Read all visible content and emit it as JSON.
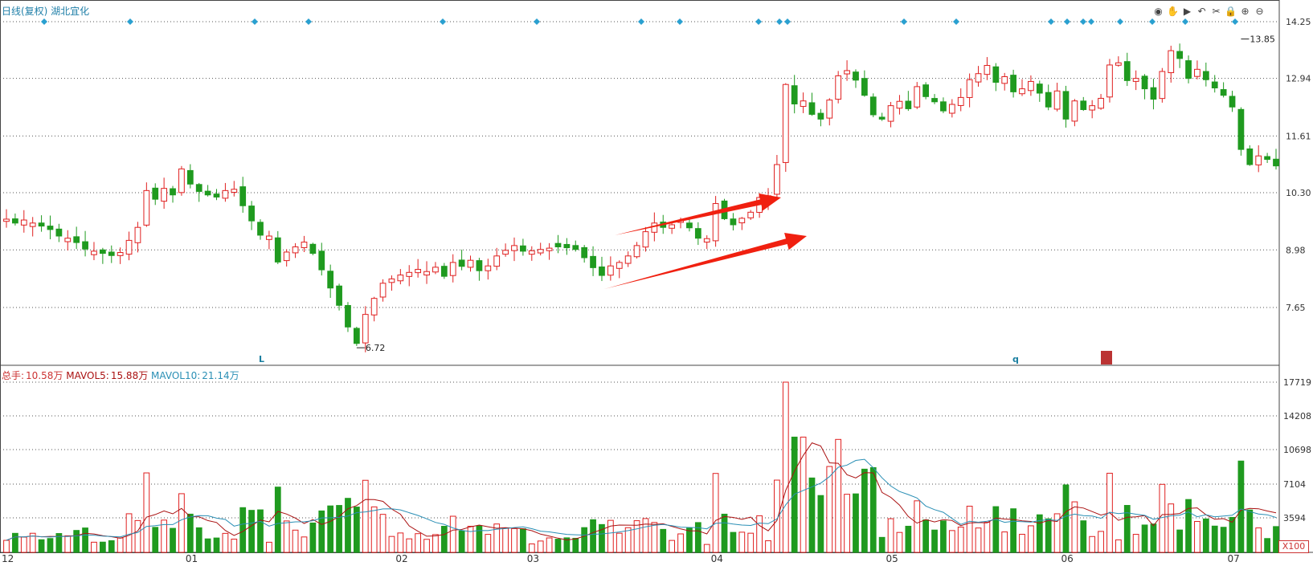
{
  "header": {
    "title": "日线(复权) 湖北宜化",
    "toolbar_icons": [
      "eye-icon",
      "hand-icon",
      "play-icon",
      "undo-icon",
      "cut-icon",
      "lock-icon",
      "zoom-in-icon",
      "zoom-out-icon"
    ]
  },
  "price_axis_labels": [
    "14.25",
    "12.94",
    "11.61",
    "10.30",
    "8.98",
    "7.65"
  ],
  "volume_axis_labels": [
    "17719",
    "14208",
    "10698",
    "7104",
    "3594"
  ],
  "x_axis_labels": [
    "12",
    "01",
    "02",
    "03",
    "04",
    "05",
    "06",
    "07"
  ],
  "markers": {
    "L": "L",
    "q": "q"
  },
  "annotations": {
    "low": "6.72",
    "high": "13.85"
  },
  "volume_legend": {
    "total_label": "总手:",
    "total_value": "10.58万",
    "ma5_label": "MAVOL5:",
    "ma5_value": "15.88万",
    "ma10_label": "MAVOL10:",
    "ma10_value": "21.14万"
  },
  "x100_label": "X100",
  "colors": {
    "up": "#e02020",
    "down": "#1f9a1f",
    "ma5": "#a11",
    "ma10": "#2a8fb5",
    "grid": "#555",
    "arrow": "#f02010"
  },
  "chart_data": {
    "type": "candlestick",
    "title": "日线(复权) 湖北宜化",
    "price_range": [
      6.3,
      14.6
    ],
    "volume_range": [
      0,
      17719
    ],
    "price_ticks": [
      14.25,
      12.94,
      11.61,
      10.3,
      8.98,
      7.65
    ],
    "volume_ticks": [
      17719,
      14208,
      10698,
      7104,
      3594
    ],
    "month_labels": [
      {
        "label": "12",
        "index": 0
      },
      {
        "label": "01",
        "index": 21
      },
      {
        "label": "02",
        "index": 45
      },
      {
        "label": "03",
        "index": 60
      },
      {
        "label": "04",
        "index": 81
      },
      {
        "label": "05",
        "index": 101
      },
      {
        "label": "06",
        "index": 121
      },
      {
        "label": "07",
        "index": 140
      }
    ],
    "closes": [
      9.69,
      9.6,
      9.67,
      9.6,
      9.53,
      9.45,
      9.3,
      9.25,
      9.15,
      9.0,
      8.95,
      8.9,
      8.85,
      8.92,
      9.2,
      9.5,
      10.35,
      10.15,
      10.4,
      10.25,
      10.85,
      10.5,
      10.33,
      10.25,
      10.2,
      10.35,
      10.38,
      10.0,
      9.65,
      9.32,
      9.3,
      8.7,
      8.93,
      9.05,
      9.16,
      8.9,
      8.52,
      8.1,
      7.7,
      7.2,
      6.82,
      7.49,
      7.86,
      8.21,
      8.31,
      8.4,
      8.46,
      8.53,
      8.48,
      8.58,
      8.37,
      8.69,
      8.6,
      8.74,
      8.5,
      8.61,
      8.84,
      8.97,
      9.08,
      8.95,
      8.96,
      8.99,
      9.02,
      9.05,
      9.03,
      8.99,
      8.8,
      8.57,
      8.39,
      8.61,
      8.69,
      8.84,
      9.08,
      9.4,
      9.6,
      9.5,
      9.56,
      9.66,
      9.49,
      9.25,
      9.24,
      10.05,
      9.7,
      9.56,
      9.71,
      9.85,
      10.19,
      10.23,
      10.95,
      12.8,
      12.35,
      12.42,
      12.11,
      12.0,
      12.44,
      13.0,
      13.12,
      12.9,
      12.55,
      12.1,
      12.0,
      12.31,
      12.41,
      12.24,
      12.75,
      12.52,
      12.4,
      12.19,
      12.34,
      12.5,
      12.91,
      13.05,
      13.24,
      12.85,
      12.98,
      12.63,
      12.7,
      12.87,
      12.6,
      12.28,
      12.65,
      12.0,
      12.42,
      12.22,
      12.31,
      12.48,
      13.25,
      13.3,
      12.89,
      12.94,
      12.7,
      12.46,
      13.1,
      13.58,
      13.4,
      12.94,
      13.15,
      12.91,
      12.72,
      12.55,
      12.28,
      11.3,
      10.95,
      11.15,
      11.07,
      10.92
    ]
  }
}
